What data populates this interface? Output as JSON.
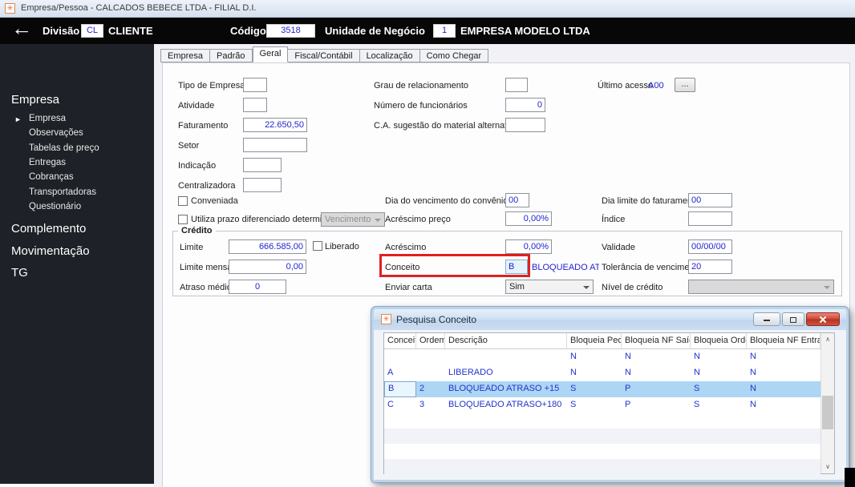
{
  "window": {
    "title": "Empresa/Pessoa - CALCADOS BEBECE LTDA - FILIAL D.I."
  },
  "icons": {
    "app": "✳",
    "back": "←",
    "selected_arrow": "►",
    "scroll_up": "∧",
    "scroll_down": "∨"
  },
  "toolbar": {
    "divisao": {
      "label": "Divisão",
      "code": "CL",
      "name": "CLIENTE"
    },
    "codigo": {
      "label": "Código",
      "value": "3518"
    },
    "unidade": {
      "label": "Unidade de Negócio",
      "code": "1",
      "name": "EMPRESA MODELO LTDA"
    }
  },
  "sidebar": {
    "sections": {
      "empresa": "Empresa",
      "complemento": "Complemento",
      "movimentacao": "Movimentação",
      "tg": "TG"
    },
    "empresa_items": [
      "Empresa",
      "Observações",
      "Tabelas de preço",
      "Entregas",
      "Cobranças",
      "Transportadoras",
      "Questionário"
    ]
  },
  "tabs": {
    "items": [
      "Empresa",
      "Padrão",
      "Geral",
      "Fiscal/Contábil",
      "Localização",
      "Como Chegar"
    ],
    "active": "Geral"
  },
  "form": {
    "tipo_empresa": {
      "label": "Tipo de Empresa",
      "value": ""
    },
    "atividade": {
      "label": "Atividade",
      "value": ""
    },
    "faturamento": {
      "label": "Faturamento",
      "value": "22.650,50"
    },
    "setor": {
      "label": "Setor",
      "value": ""
    },
    "indicacao": {
      "label": "Indicação",
      "value": ""
    },
    "centralizadora": {
      "label": "Centralizadora",
      "value": ""
    },
    "grau": {
      "label": "Grau de relacionamento",
      "value": ""
    },
    "funcionarios": {
      "label": "Número de funcionários",
      "value": "0"
    },
    "ca_sugestao": {
      "label": "C.A. sugestão do material alternativo",
      "value": ""
    },
    "ultimo_acesso": {
      "label": "Último acesso",
      "value": "A00",
      "button": "..."
    },
    "conveniada": {
      "label": "Conveniada"
    },
    "dia_vencimento": {
      "label": "Dia do vencimento do convênio",
      "value": "00"
    },
    "dia_limite": {
      "label": "Dia limite do faturamento",
      "value": "00"
    },
    "utiliza_prazo": {
      "label": "Utiliza prazo diferenciado determinado por",
      "select": "Vencimento"
    },
    "acrescimo_preco": {
      "label": "Acréscimo preço",
      "value": "0,00%"
    },
    "indice": {
      "label": "Índice",
      "value": ""
    }
  },
  "credito": {
    "legend": "Crédito",
    "limite": {
      "label": "Limite",
      "value": "666.585,00"
    },
    "liberado": {
      "label": "Liberado"
    },
    "limite_mensal": {
      "label": "Limite mensal",
      "value": "0,00"
    },
    "atraso_medio": {
      "label": "Atraso médio",
      "value": "0"
    },
    "acrescimo": {
      "label": "Acréscimo",
      "value": "0,00%"
    },
    "conceito": {
      "label": "Conceito",
      "value": "B",
      "description": "BLOQUEADO ATRAS"
    },
    "enviar_carta": {
      "label": "Enviar carta",
      "value": "Sim"
    },
    "validade": {
      "label": "Validade",
      "value": "00/00/00"
    },
    "tolerancia": {
      "label": "Tolerância de vencimento",
      "value": "20"
    },
    "nivel_credito": {
      "label": "Nível de crédito",
      "value": ""
    }
  },
  "popup": {
    "title": "Pesquisa Conceito",
    "table": {
      "columns": [
        "Conceito",
        "Ordem",
        "Descrição",
        "Bloqueia Pedido",
        "Bloqueia NF Saída",
        "Bloqueia Ordem",
        "Bloqueia NF Entrada"
      ],
      "rows": [
        {
          "cells": [
            "",
            "",
            "",
            "N",
            "N",
            "N",
            "N"
          ]
        },
        {
          "cells": [
            "A",
            "",
            "LIBERADO",
            "N",
            "N",
            "N",
            "N"
          ]
        },
        {
          "cells": [
            "B",
            "2",
            "BLOQUEADO ATRASO +15",
            "S",
            "P",
            "S",
            "N"
          ],
          "selected": true
        },
        {
          "cells": [
            "C",
            "3",
            "BLOQUEADO ATRASO+180",
            "S",
            "P",
            "S",
            "N"
          ]
        }
      ]
    }
  }
}
